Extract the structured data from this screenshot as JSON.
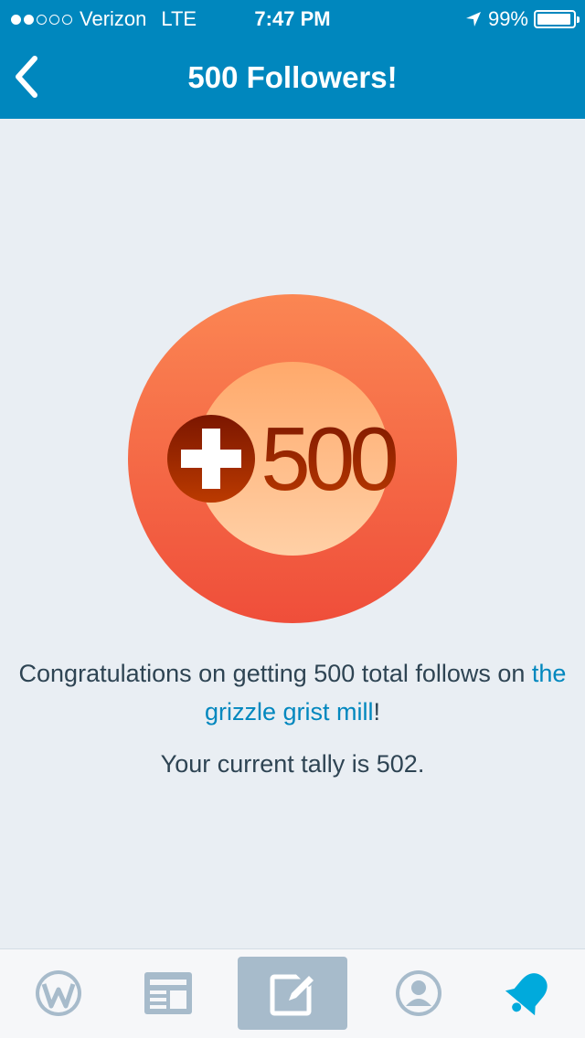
{
  "status_bar": {
    "carrier": "Verizon",
    "network": "LTE",
    "time": "7:47 PM",
    "battery": "99%",
    "signal_bars": 2,
    "signal_total": 5
  },
  "nav": {
    "title": "500 Followers!",
    "back_icon": "chevron-left-icon"
  },
  "achievement": {
    "badge_text": "500",
    "badge_icon": "plus-icon",
    "message_prefix": "Congratulations on getting 500 total follows on ",
    "site_link": "the grizzle grist mill",
    "message_suffix": "!",
    "tally": "Your current tally is 502."
  },
  "tabs": [
    {
      "icon": "wordpress-icon",
      "selected": false
    },
    {
      "icon": "reader-icon",
      "selected": false
    },
    {
      "icon": "write-post-icon",
      "selected": true
    },
    {
      "icon": "profile-icon",
      "selected": false
    },
    {
      "icon": "notifications-icon",
      "selected": false
    }
  ],
  "colors": {
    "header": "#0087be",
    "background": "#e9eef3",
    "link": "#0087be",
    "text": "#2e4453",
    "tab_icon": "#a7bbcb",
    "tab_active": "#00aadc",
    "badge_outer": "#f2603f",
    "badge_text": "#9e2a00"
  }
}
